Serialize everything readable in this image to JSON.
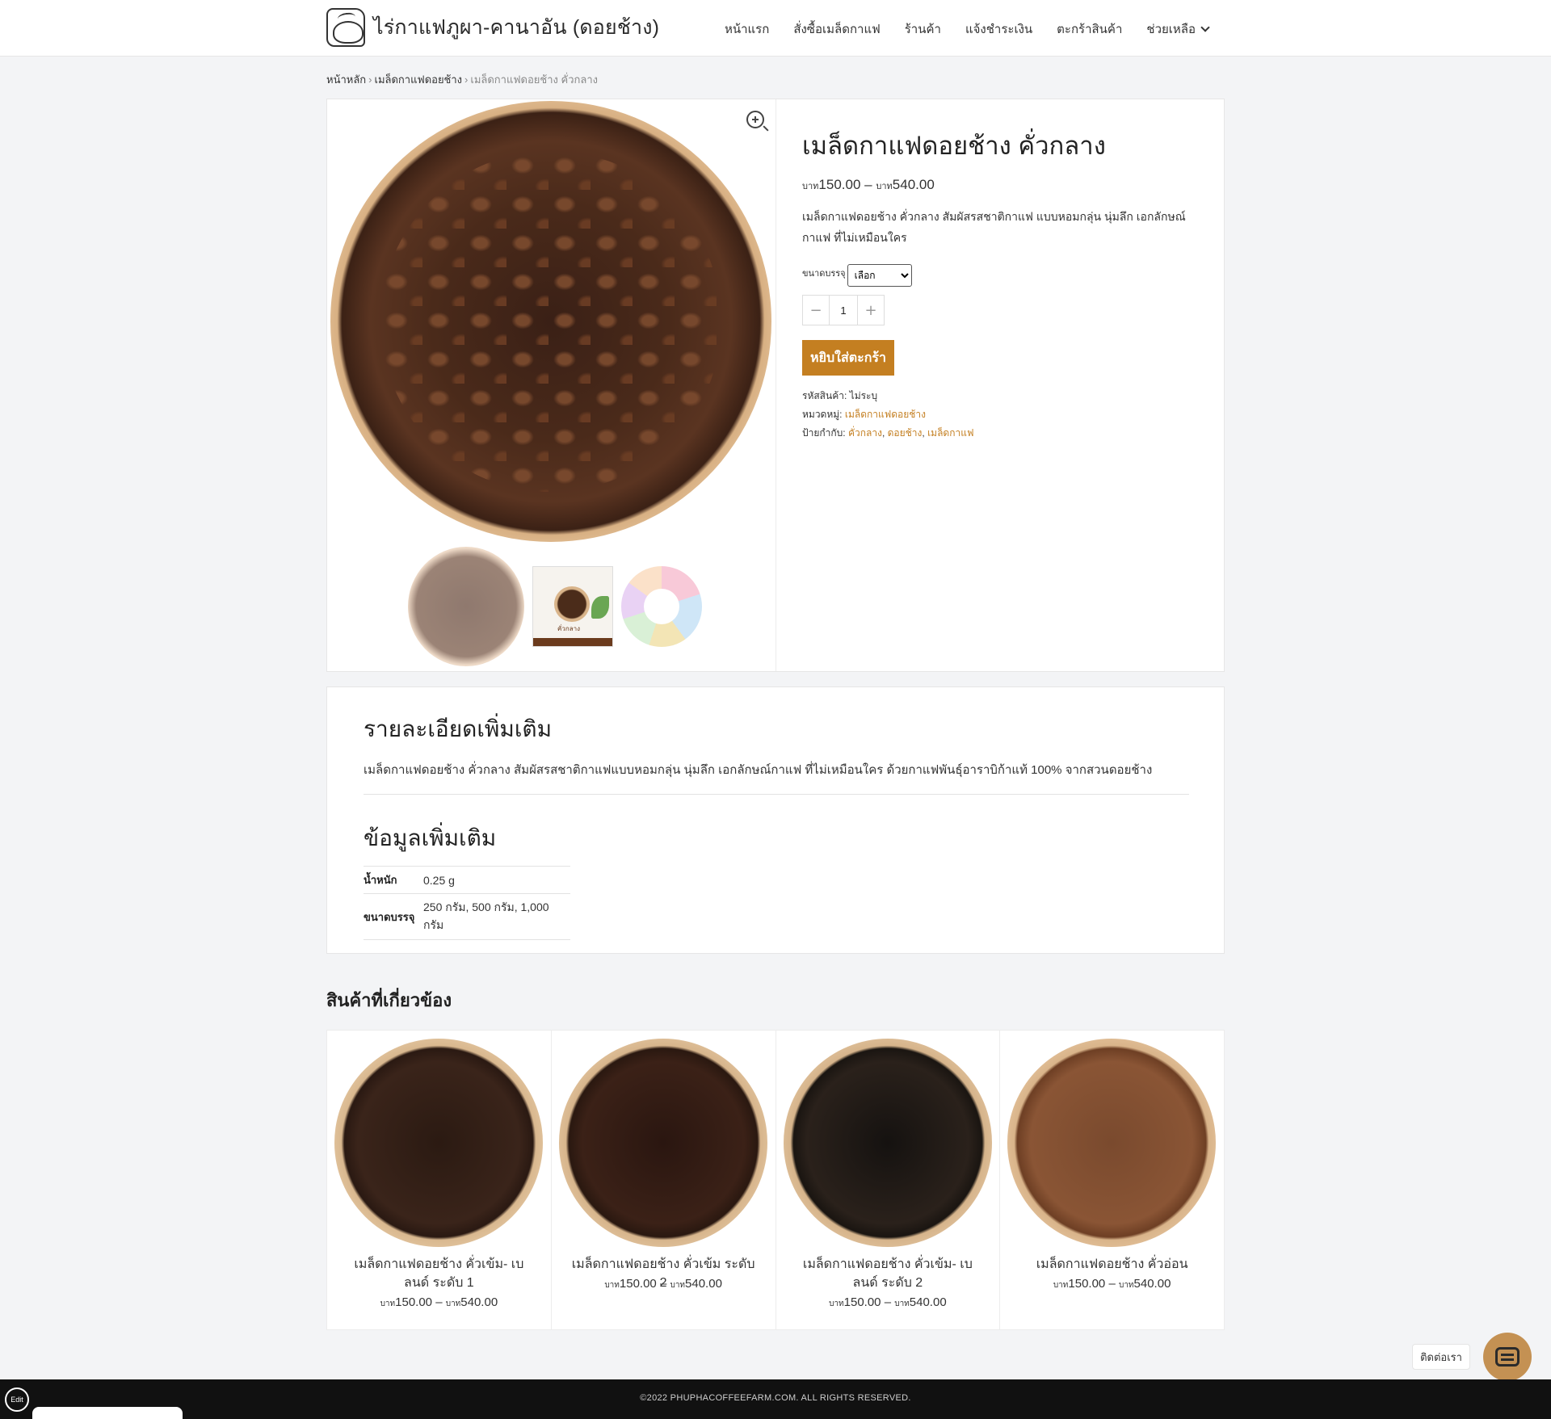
{
  "header": {
    "site_title": "ไร่กาแฟภูผา-คานาอัน (ดอยช้าง)",
    "nav": [
      "หน้าแรก",
      "สั่งซื้อเมล็ดกาแฟ",
      "ร้านค้า",
      "แจ้งชำระเงิน",
      "ตะกร้าสินค้า",
      "ช่วยเหลือ"
    ]
  },
  "breadcrumb": {
    "home": "หน้าหลัก",
    "category": "เมล็ดกาแฟดอยช้าง",
    "current": "เมล็ดกาแฟดอยช้าง คั่วกลาง",
    "sep": "›"
  },
  "product": {
    "title": "เมล็ดกาแฟดอยช้าง คั่วกลาง",
    "currency": "บาท",
    "price_min": "150.00",
    "price_max": "540.00",
    "price_dash": "–",
    "short_description": "เมล็ดกาแฟดอยช้าง คั่วกลาง สัมผัสรสชาติกาแฟ แบบหอมกลุ่น นุ่มลึก เอกลักษณ์กาแฟ ที่ไม่เหมือนใคร",
    "variation_label": "ขนาดบรรจุ",
    "variation_selected": "เลือก",
    "qty_minus": "−",
    "qty_value": "1",
    "qty_plus": "+",
    "add_to_cart": "หยิบใส่ตะกร้า",
    "sku_label": "รหัสสินค้า:",
    "sku_value": "ไม่ระบุ",
    "category_label": "หมวดหมู่:",
    "category_value": "เมล็ดกาแฟดอยช้าง",
    "tags_label": "ป้ายกำกับ:",
    "tags": [
      "คั่วกลาง",
      "ดอยช้าง",
      "เมล็ดกาแฟ"
    ],
    "thumb2_caption": "คั่วกลาง"
  },
  "details": {
    "desc_heading": "รายละเอียดเพิ่มเติม",
    "desc_text": "เมล็ดกาแฟดอยช้าง คั่วกลาง สัมผัสรสชาติกาแฟแบบหอมกลุ่น นุ่มลึก เอกลักษณ์กาแฟ ที่ไม่เหมือนใคร ด้วยกาแฟพันธุ์อาราบิก้าแท้ 100% จากสวนดอยช้าง",
    "info_heading": "ข้อมูลเพิ่มเติม",
    "attributes": [
      {
        "name": "น้ำหนัก",
        "value": "0.25 g"
      },
      {
        "name": "ขนาดบรรจุ",
        "value": "250 กรัม, 500 กรัม, 1,000 กรัม"
      }
    ]
  },
  "related": {
    "heading": "สินค้าที่เกี่ยวข้อง",
    "items": [
      {
        "name": "เมล็ดกาแฟดอยช้าง คั่วเข้ม- เบลนด์ ระดับ 1",
        "price": "150.00",
        "price_max": "540.00"
      },
      {
        "name": "เมล็ดกาแฟดอยช้าง คั่วเข้ม ระดับ 2",
        "price": "150.00",
        "price_max": "540.00"
      },
      {
        "name": "เมล็ดกาแฟดอยช้าง คั่วเข้ม- เบลนด์ ระดับ 2",
        "price": "150.00",
        "price_max": "540.00"
      },
      {
        "name": "เมล็ดกาแฟดอยช้าง คั่วอ่อน",
        "price": "150.00",
        "price_max": "540.00"
      }
    ]
  },
  "chat": {
    "label": "ติดต่อเรา"
  },
  "footer": {
    "copyright": "©2022 PHUPHACOFFEEFARM.COM. ALL RIGHTS RESERVED.",
    "edit": "Edit"
  },
  "colors": {
    "accent": "#c47f21",
    "footer_bg": "#111111",
    "chat": "#c49153"
  }
}
